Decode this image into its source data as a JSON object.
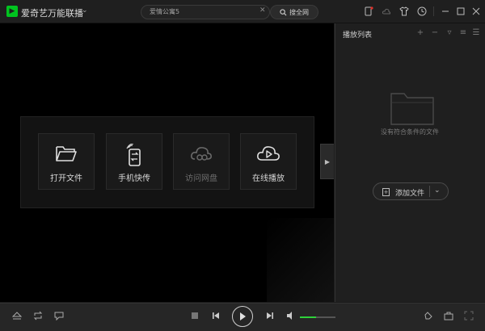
{
  "titlebar": {
    "app_title": "爱奇艺万能联播",
    "search_value": "爱情公寓5",
    "search_all_label": "搜全网"
  },
  "tiles": [
    {
      "label": "打开文件",
      "icon": "folder-open-icon",
      "enabled": true
    },
    {
      "label": "手机快传",
      "icon": "phone-transfer-icon",
      "enabled": true
    },
    {
      "label": "访问网盘",
      "icon": "cloud-drive-icon",
      "enabled": false
    },
    {
      "label": "在线播放",
      "icon": "cloud-play-icon",
      "enabled": true
    }
  ],
  "playlist": {
    "title": "播放列表",
    "empty_text": "没有符合条件的文件",
    "add_file_label": "添加文件"
  },
  "player": {
    "volume_level": 0.45
  },
  "colors": {
    "accent": "#2ed13a",
    "brand": "#00c31f",
    "background": "#000000"
  }
}
